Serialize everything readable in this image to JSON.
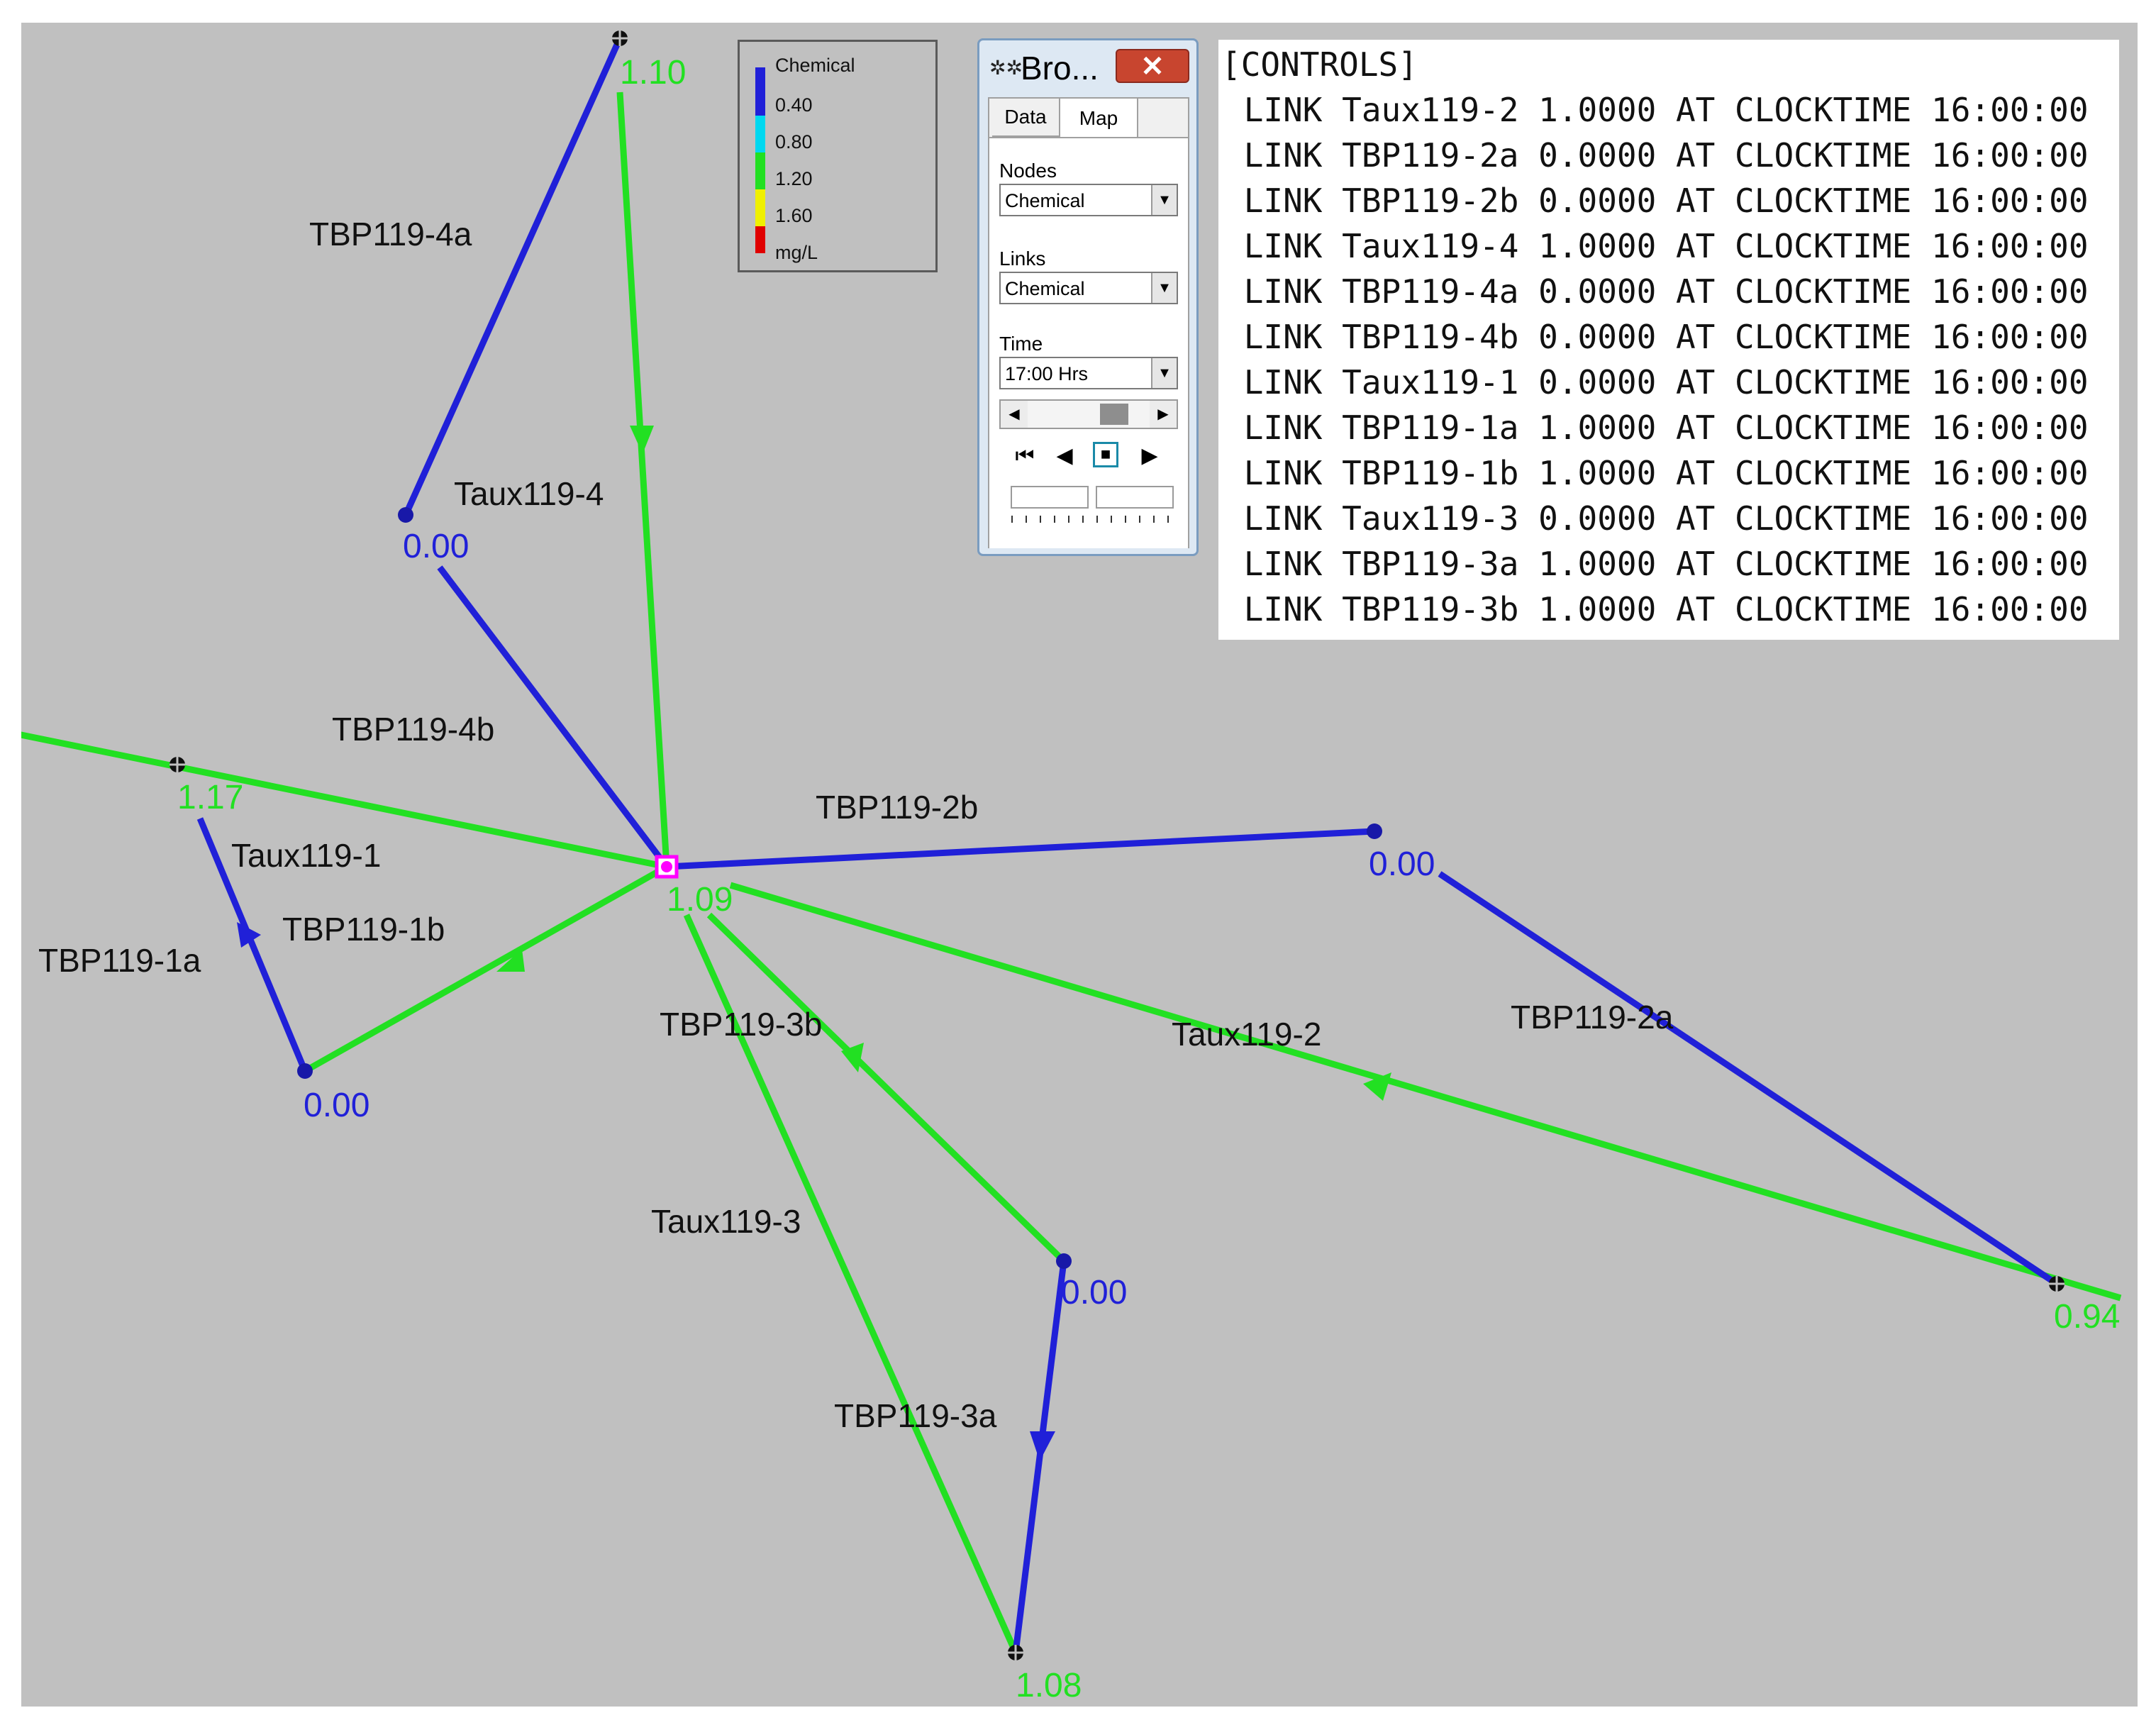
{
  "colors": {
    "background": "#c0c0c0",
    "blue": "#2020d8",
    "green": "#22e022",
    "cyan": "#00d8f0",
    "yellow": "#f0f000",
    "red": "#e00000",
    "selected_node": "#ff00ff"
  },
  "legend": {
    "title": "Chemical",
    "ticks": [
      "0.40",
      "0.80",
      "1.20",
      "1.60"
    ],
    "unit": "mg/L"
  },
  "browser": {
    "title": "Bro...",
    "close_icon": "close-icon",
    "tabs": [
      "Data",
      "Map"
    ],
    "active_tab": "Map",
    "nodes_label": "Nodes",
    "nodes_value": "Chemical",
    "links_label": "Links",
    "links_value": "Chemical",
    "time_label": "Time",
    "time_value": "17:00 Hrs",
    "animation_icons": [
      "rewind-icon",
      "step-back-icon",
      "stop-icon",
      "play-icon"
    ]
  },
  "controls": {
    "header": "[CONTROLS]",
    "lines": [
      " LINK Taux119-2 1.0000 AT CLOCKTIME 16:00:00",
      " LINK TBP119-2a 0.0000 AT CLOCKTIME 16:00:00",
      " LINK TBP119-2b 0.0000 AT CLOCKTIME 16:00:00",
      " LINK Taux119-4 1.0000 AT CLOCKTIME 16:00:00",
      " LINK TBP119-4a 0.0000 AT CLOCKTIME 16:00:00",
      " LINK TBP119-4b 0.0000 AT CLOCKTIME 16:00:00",
      " LINK Taux119-1 0.0000 AT CLOCKTIME 16:00:00",
      " LINK TBP119-1a 1.0000 AT CLOCKTIME 16:00:00",
      " LINK TBP119-1b 1.0000 AT CLOCKTIME 16:00:00",
      " LINK Taux119-3 0.0000 AT CLOCKTIME 16:00:00",
      " LINK TBP119-3a 1.0000 AT CLOCKTIME 16:00:00",
      " LINK TBP119-3b 1.0000 AT CLOCKTIME 16:00:00"
    ]
  },
  "network": {
    "link_labels": {
      "tbp119_4a": "TBP119-4a",
      "taux119_4": "Taux119-4",
      "tbp119_4b": "TBP119-4b",
      "tbp119_2b": "TBP119-2b",
      "taux119_1": "Taux119-1",
      "tbp119_1b": "TBP119-1b",
      "tbp119_1a": "TBP119-1a",
      "tbp119_3b": "TBP119-3b",
      "taux119_2": "Taux119-2",
      "tbp119_2a": "TBP119-2a",
      "taux119_3": "Taux119-3",
      "tbp119_3a": "TBP119-3a"
    },
    "node_values": {
      "top": "1.10",
      "upper_left": "0.00",
      "left": "1.17",
      "center": "1.09",
      "right": "0.00",
      "bottom_left": "0.00",
      "middle": "0.00",
      "far_right": "0.94",
      "bottom": "1.08"
    }
  }
}
